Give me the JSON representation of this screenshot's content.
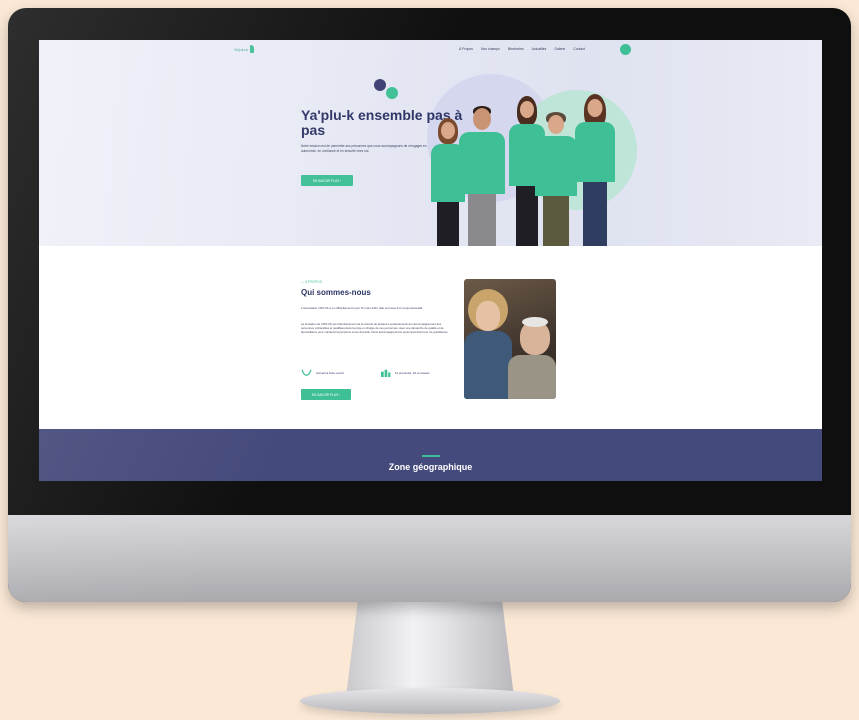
{
  "nav": {
    "logo_text": "Ya'plu-k",
    "menu": [
      "À Propos",
      "Nos champs",
      "Bénévoles",
      "Actualités",
      "Galerie",
      "Contact"
    ]
  },
  "hero": {
    "title": "Ya'plu-k ensemble pas à pas",
    "text": "Notre mission est de permettre aux personnes que nous accompagnons de s'engager en autonomie, en confiance et en sécurité chez soi.",
    "button": "EN SAVOIR PLUS  ›"
  },
  "about": {
    "eyebrow": "— À PROPOS",
    "title": "Qui sommes-nous",
    "para1": "L'association YAPLUK a vu officiellement le jour fin mars 2021. Elle est issue d'un projet associatif.",
    "para2": "La fondation de YAPLUK est l'aboutissement de la volonté de plusieurs professionnels de l'accompagnement des personnes vulnérables et qualifiées dans la prise en charge de ces personnes, avec une démarche de qualité et de bienveillance pour maintenir la personne à son domicile. Nous accompagnons les personnes dans leur vie quotidienne.",
    "feature1": "Accueil à bras ouvert",
    "feature2": "11 proximité, 22 et réseau",
    "button": "EN SAVOIR PLUS  ›"
  },
  "zone": {
    "title": "Zone géographique"
  },
  "colors": {
    "brand_green": "#3fbf96",
    "brand_navy": "#2d3466",
    "zone_bg": "#454a7c",
    "backdrop": "#fbe9d6"
  }
}
